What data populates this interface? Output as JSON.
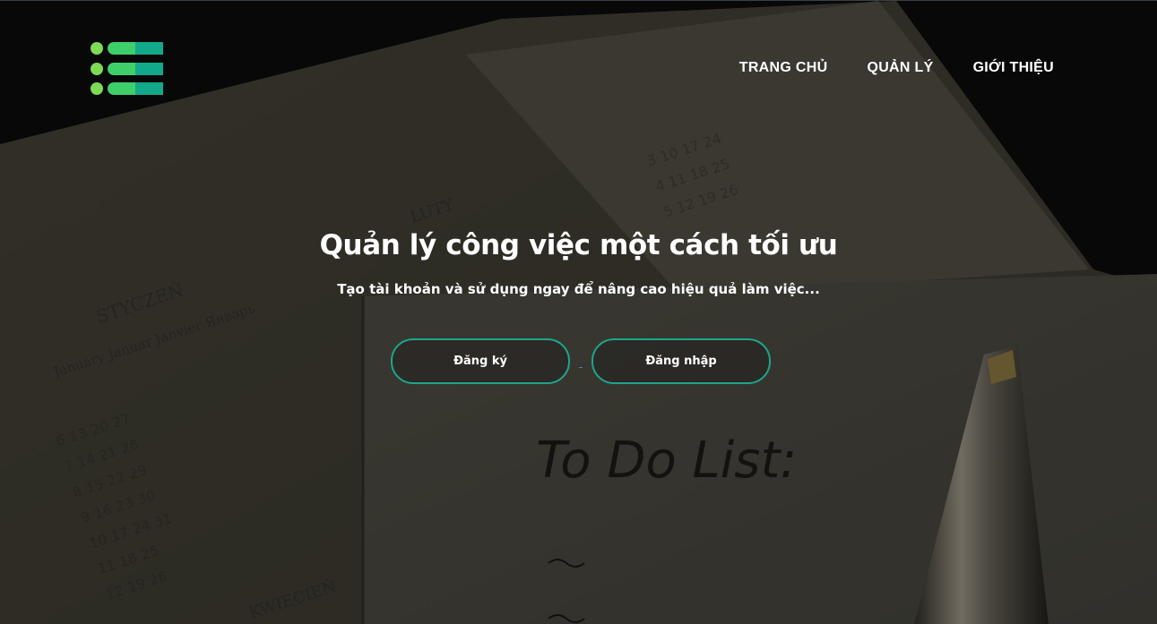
{
  "nav": {
    "items": [
      {
        "label": "TRANG CHỦ"
      },
      {
        "label": "QUẢN LÝ"
      },
      {
        "label": "GIỚI THIỆU"
      }
    ]
  },
  "hero": {
    "title": "Quản lý công việc một cách tối ưu",
    "subtitle": "Tạo tài khoản và sử dụng ngay để nâng cao hiệu quả làm việc...",
    "register_label": "Đăng ký",
    "login_label": "Đăng nhập"
  },
  "background": {
    "handwriting": "To Do List:",
    "calendar_month": "STYCZEŃ",
    "calendar_languages": "January Januar Janvier Январь",
    "calendar_month_2": "LUTY",
    "calendar_month_3": "KWIECIEŃ"
  },
  "colors": {
    "accent": "#1ea58e",
    "logo_green_light": "#7ed957",
    "logo_green": "#3ecf6a",
    "logo_teal": "#12a98a"
  }
}
